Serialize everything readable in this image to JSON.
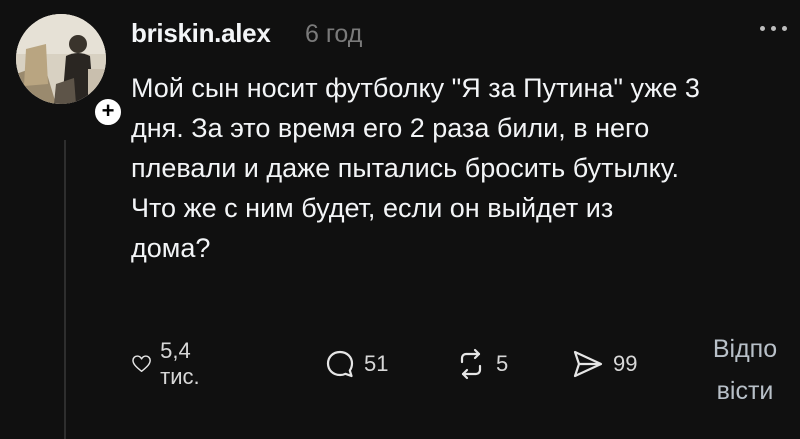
{
  "post": {
    "username": "briskin.alex",
    "time": "6 год",
    "text_lines": [
      "Мой сын носит футболку \"Я за Путина\" уже 3",
      "дня. За это время его 2 раза били, в него",
      "плевали и даже пытались бросить бутылку.",
      "Что же с ним будет, если он выйдет из",
      "дома?"
    ],
    "actions": {
      "likes": "5,4 тис.",
      "comments": "51",
      "reposts": "5",
      "shares": "99"
    },
    "reply_label_lines": [
      "Відпо",
      "вісти"
    ],
    "follow_symbol": "+",
    "icons": {
      "like": "heart-icon",
      "comment": "comment-bubble-icon",
      "repost": "repost-icon",
      "share": "send-icon",
      "more": "more-dots-icon"
    }
  }
}
